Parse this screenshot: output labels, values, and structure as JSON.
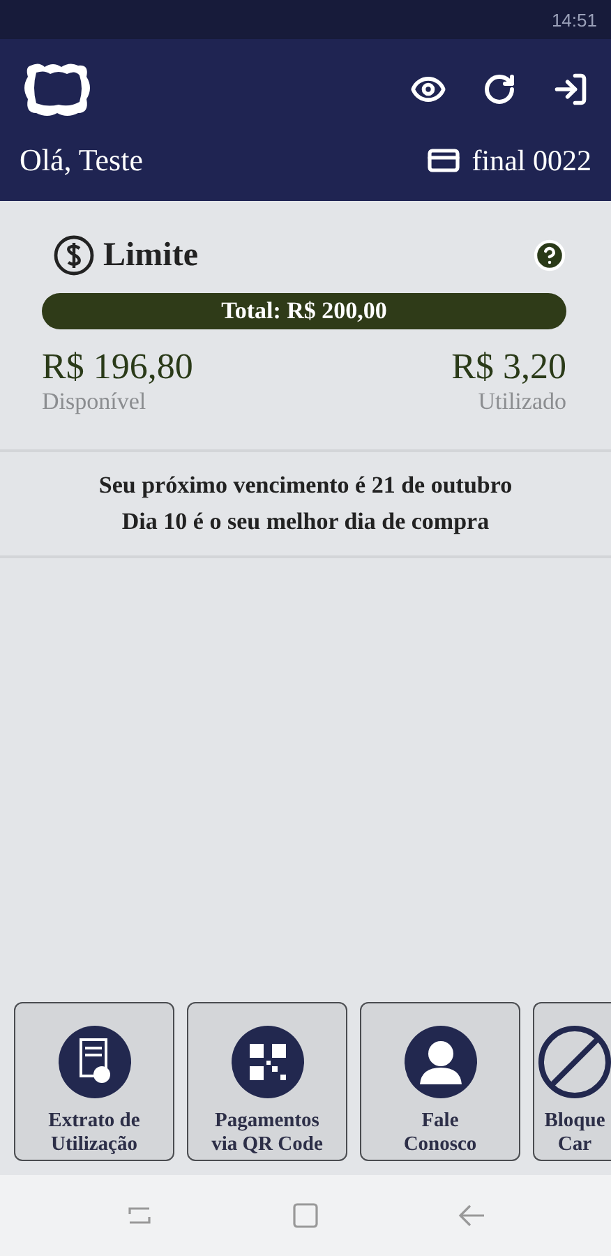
{
  "status_bar": {
    "time": "14:51"
  },
  "header": {
    "greeting": "Olá, Teste",
    "card_label": "final 0022"
  },
  "limit": {
    "title": "Limite",
    "total": "Total: R$ 200,00",
    "available_value": "R$ 196,80",
    "available_label": "Disponível",
    "used_value": "R$ 3,20",
    "used_label": "Utilizado"
  },
  "due_info": [
    "Seu próximo vencimento é 21 de outubro",
    "Dia 10 é o seu melhor dia de compra"
  ],
  "shortcuts": [
    {
      "kind": "statement",
      "lines": [
        "Extrato de",
        "Utilização"
      ]
    },
    {
      "kind": "qr",
      "lines": [
        "Pagamentos",
        "via QR Code"
      ]
    },
    {
      "kind": "contact",
      "lines": [
        "Fale",
        "Conosco"
      ]
    },
    {
      "kind": "block",
      "lines": [
        "Bloque",
        "Car"
      ]
    }
  ]
}
